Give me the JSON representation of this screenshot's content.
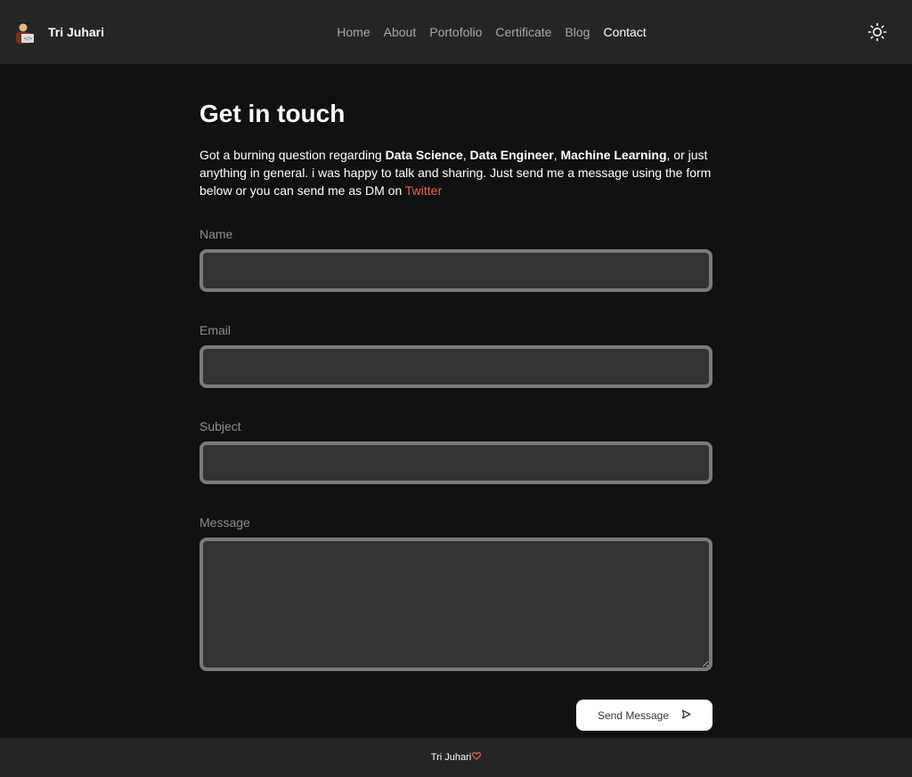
{
  "header": {
    "brand_name": "Tri Juhari",
    "nav": [
      {
        "label": "Home"
      },
      {
        "label": "About"
      },
      {
        "label": "Portofolio"
      },
      {
        "label": "Certificate"
      },
      {
        "label": "Blog"
      },
      {
        "label": "Contact"
      }
    ],
    "active_nav": "Contact",
    "theme_toggle_icon": "sun-icon"
  },
  "main": {
    "title": "Get in touch",
    "intro": {
      "part1": "Got a burning question regarding ",
      "topic1": "Data Science",
      "sep1": ", ",
      "topic2": "Data Engineer",
      "sep2": ", ",
      "topic3": "Machine Learning",
      "part2": ", or just anything in general. i was happy to talk and sharing. Just send me a message using the form below or you can send me as DM on ",
      "link": "Twitter"
    },
    "form": {
      "name_label": "Name",
      "name_value": "",
      "email_label": "Email",
      "email_value": "",
      "subject_label": "Subject",
      "subject_value": "",
      "message_label": "Message",
      "message_value": "",
      "send_label": "Send Message",
      "send_icon": "send-icon"
    }
  },
  "footer": {
    "text": "Tri Juhari",
    "icon": "heart-icon"
  },
  "colors": {
    "background": "#111111",
    "header_bg": "#252525",
    "accent": "#e0694f",
    "input_bg": "#333333",
    "input_border": "#7a7a7a"
  }
}
